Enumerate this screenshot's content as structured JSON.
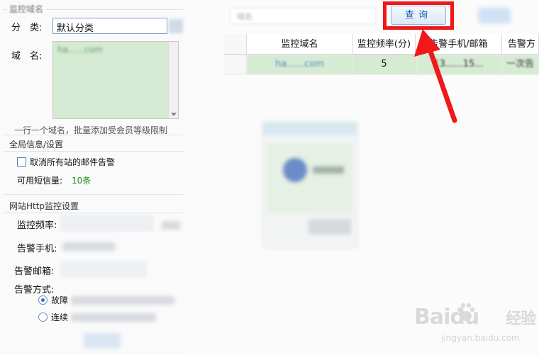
{
  "left_panel": {
    "group1_title": "监控域名",
    "category_label": "分　类:",
    "category_value": "默认分类",
    "domain_label": "域　名:",
    "domain_value": "ha......com",
    "hint": "一行一个域名，批量添加受会员等级限制"
  },
  "global_settings": {
    "title": "全局信息/设置",
    "cancel_alerts_label": "取消所有站的邮件告警",
    "sms_label": "可用短信量:",
    "sms_value": "10条"
  },
  "http_settings": {
    "title": "网站Http监控设置",
    "frequency_label": "监控频率:",
    "phone_label": "告警手机:",
    "email_label": "告警邮箱:",
    "method_label": "告警方式:",
    "option1_label": "故障",
    "option2_label": "连续"
  },
  "toolbar": {
    "search_placeholder": "域名",
    "query_label": "查询"
  },
  "table": {
    "headers": [
      "监控域名",
      "监控频率(分)",
      "告警手机/邮箱",
      "告警方"
    ],
    "rows": [
      [
        "ha......com",
        "5",
        "13......15...",
        "一次告"
      ]
    ]
  },
  "watermark": {
    "brand": "Baidu",
    "brand_cn": "经验",
    "url": "jingyan.baidu.com"
  },
  "colors": {
    "highlight": "#f01818",
    "row_green": "#d7ebd4",
    "sms_green": "#1a8f1a",
    "query_text": "#1d5fae"
  }
}
